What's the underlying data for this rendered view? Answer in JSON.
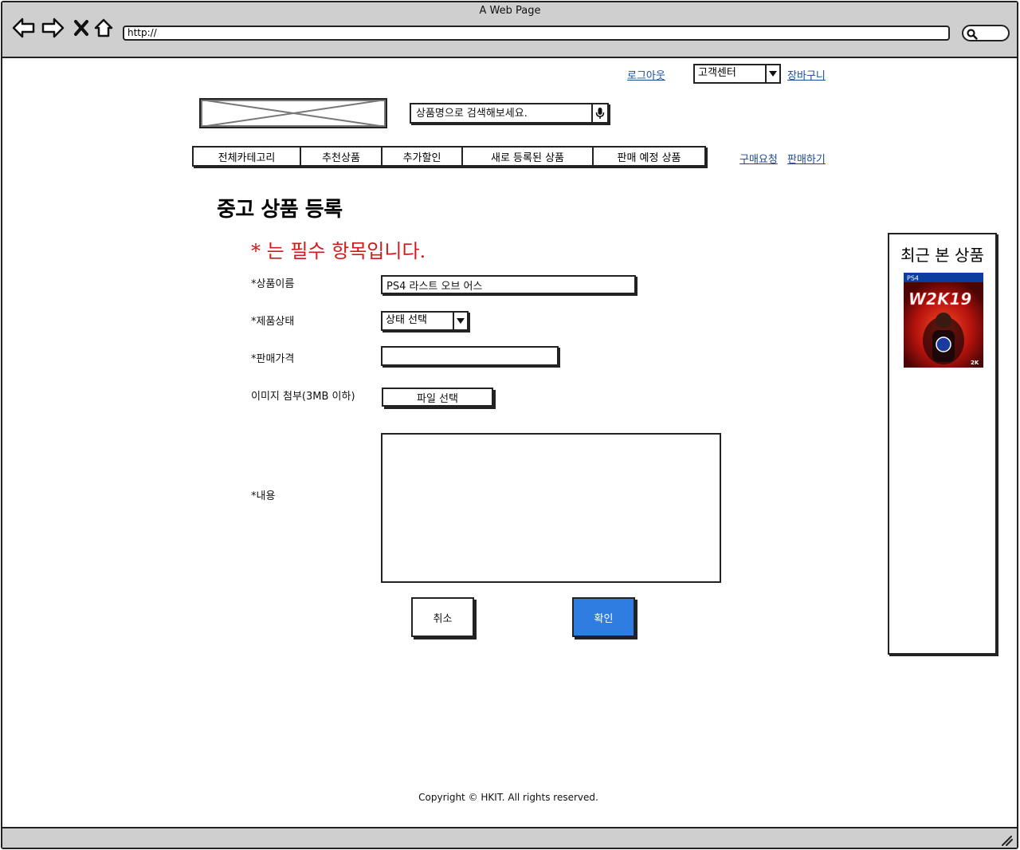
{
  "browser": {
    "title": "A Web Page",
    "url": "http://"
  },
  "header": {
    "logout_label": "로그아웃",
    "customer_center_selected": "고객센터",
    "cart_label": "장바구니",
    "search_placeholder": "상품명으로 검색해보세요.",
    "categories": [
      {
        "label": "전체카테고리"
      },
      {
        "label": "추천상품"
      },
      {
        "label": "추가할인"
      },
      {
        "label": "새로 등록된 상품"
      },
      {
        "label": "판매 예정 상품"
      }
    ],
    "purchase_request_label": "구매요청",
    "sell_label": "판매하기"
  },
  "form": {
    "page_title": "중고 상품 등록",
    "required_note": "* 는 필수 항목입니다.",
    "product_name_label": "*상품이름",
    "product_name_value": "PS4 라스트 오브 어스",
    "condition_label": "*제품상태",
    "condition_selected": "상태 선택",
    "price_label": "*판매가격",
    "price_value": "",
    "image_label": "이미지 첨부(3MB 이하)",
    "file_button_label": "파일 선택",
    "content_label": "*내용",
    "content_value": "",
    "cancel_label": "취소",
    "confirm_label": "확인"
  },
  "recent": {
    "title": "최근 본 상품",
    "items": [
      {
        "platform": "PS4",
        "game_title": "W2K19",
        "badge": "2K"
      }
    ]
  },
  "footer": {
    "copyright": "Copyright © HKIT. All rights reserved."
  },
  "colors": {
    "accent_button": "#2f7de1",
    "required_text": "#d11a1a",
    "link": "#1a4a9c",
    "chrome": "#cfcfcf"
  }
}
